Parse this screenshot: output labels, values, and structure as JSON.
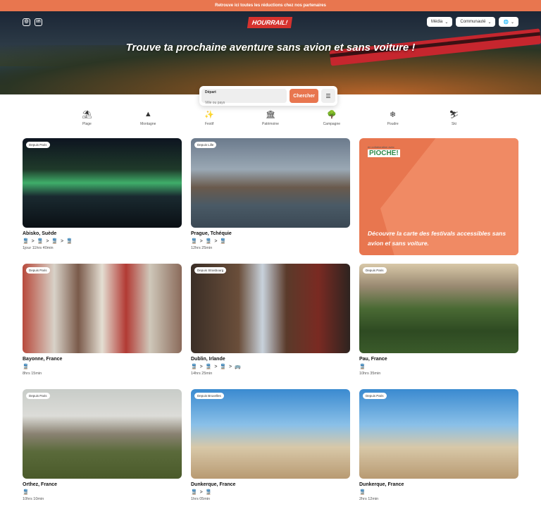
{
  "promo_bar": "Retrouve ici toutes les réductions chez nos partenaires",
  "header": {
    "logo": "HOURRAIL!",
    "nav": [
      {
        "label": "Média"
      },
      {
        "label": "Communauté"
      }
    ],
    "headline": "Trouve ta prochaine aventure sans avion et sans voiture !"
  },
  "search": {
    "label": "Départ",
    "placeholder": "Ville ou pays",
    "button": "Chercher"
  },
  "categories": [
    {
      "label": "Plage",
      "icon": "umbrella-icon"
    },
    {
      "label": "Montagne",
      "icon": "mountain-icon"
    },
    {
      "label": "Festif",
      "icon": "party-icon"
    },
    {
      "label": "Patrimoine",
      "icon": "monument-icon"
    },
    {
      "label": "Campagne",
      "icon": "tree-icon"
    },
    {
      "label": "Poudre",
      "icon": "snowflake-icon"
    },
    {
      "label": "Ski",
      "icon": "ski-icon"
    }
  ],
  "cards": [
    {
      "badge": "Depuis Paris",
      "name": "Abisko, Suède",
      "modes": "🚆 > 🚆 > 🚆 > 🚆",
      "duration": "1jour 11hrs 40min"
    },
    {
      "badge": "Depuis Lille",
      "name": "Prague, Tchéquie",
      "modes": "🚆 > 🚆 > 🚆",
      "duration": "12hrs 25min"
    },
    {
      "badge": "Depuis Paris",
      "name": "Bayonne, France",
      "modes": "🚆",
      "duration": "8hrs 15min"
    },
    {
      "badge": "Depuis Strasbourg",
      "name": "Dublin, Irlande",
      "modes": "🚆 > 🚆 > 🚆 > 🚌",
      "duration": "14hrs 25min"
    },
    {
      "badge": "Depuis Paris",
      "name": "Pau, France",
      "modes": "🚆",
      "duration": "10hrs 35min"
    },
    {
      "badge": "Depuis Paris",
      "name": "Orthez, France",
      "modes": "🚆",
      "duration": "10hrs 10min"
    },
    {
      "badge": "Depuis Bruxelles",
      "name": "Dunkerque, France",
      "modes": "🚆 > 🚆",
      "duration": "1hrs 05min"
    },
    {
      "badge": "Depuis Paris",
      "name": "Dunkerque, France",
      "modes": "🚆",
      "duration": "2hrs 12min"
    }
  ],
  "promo_card": {
    "pre": "en collaboration avec",
    "brand": "PIOCHE!",
    "text": "Découvre la carte des festivals accessibles sans avion et sans voiture."
  }
}
